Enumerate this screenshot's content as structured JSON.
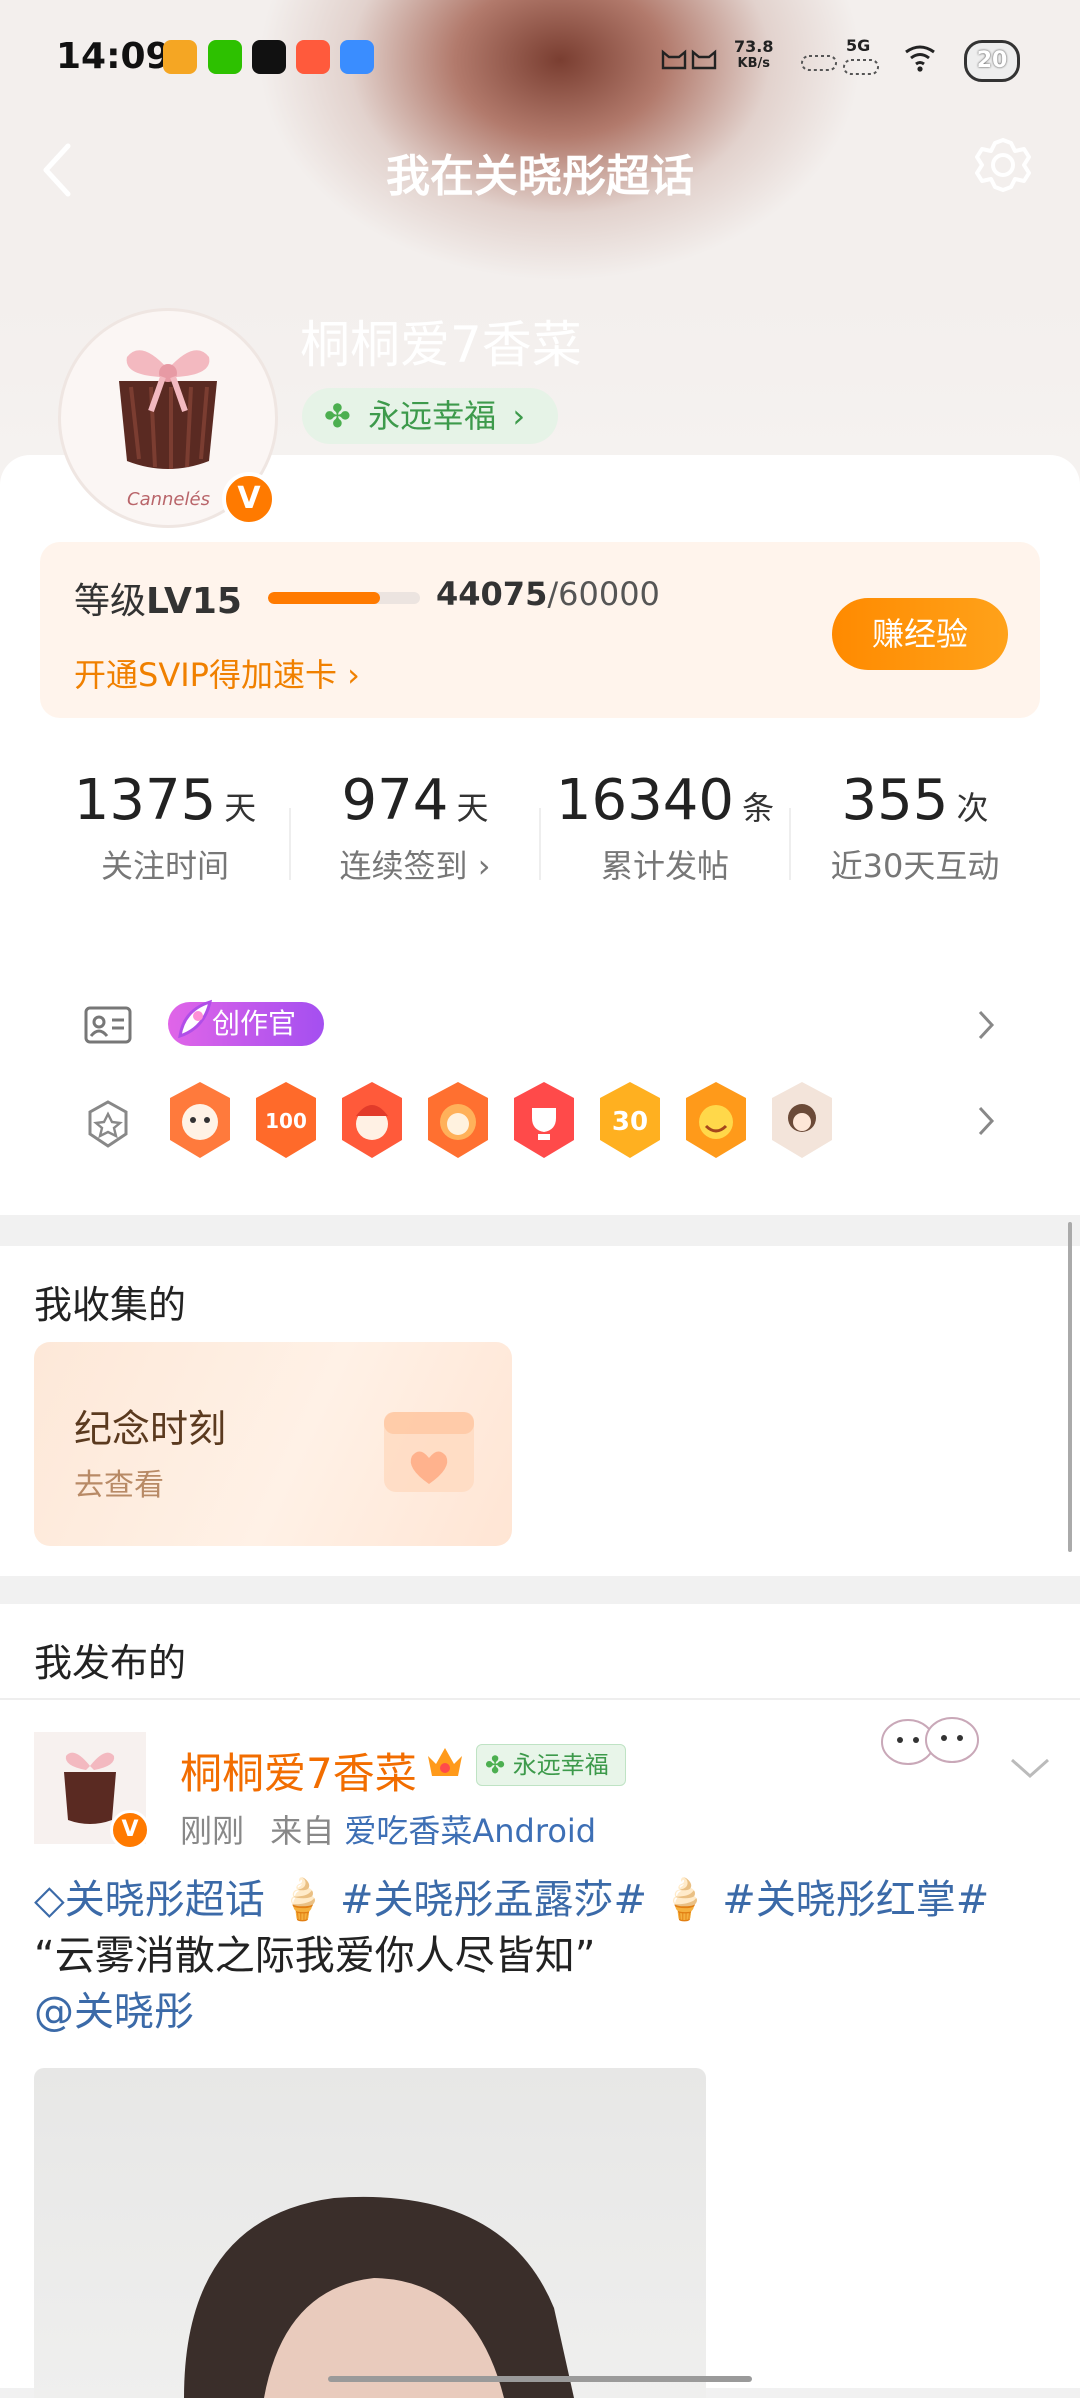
{
  "status_bar": {
    "time": "14:09",
    "speed_value": "73.8",
    "speed_unit": "KB/s",
    "signal_label": "5G",
    "battery": "20",
    "app_icons": [
      "weibo-icon",
      "wechat-icon",
      "tiktok-icon",
      "app-icon-red",
      "app-icon-blue"
    ]
  },
  "nav": {
    "title": "我在关晓彤超话"
  },
  "profile": {
    "nickname": "桐桐爱7香菜",
    "luck_badge": "永远幸福",
    "avatar_caption": "Cannelés",
    "verified_mark": "V"
  },
  "level": {
    "label_prefix": "等级",
    "level": "LV15",
    "progress_current": "44075",
    "progress_total": "/60000",
    "progress_fraction": 0.7346,
    "svip_text": "开通SVIP得加速卡",
    "earn_button": "赚经验"
  },
  "stats": [
    {
      "value": "1375",
      "unit": "天",
      "label": "关注时间"
    },
    {
      "value": "974",
      "unit": "天",
      "label": "连续签到"
    },
    {
      "value": "16340",
      "unit": "条",
      "label": "累计发帖"
    },
    {
      "value": "355",
      "unit": "次",
      "label": "近30天互动"
    }
  ],
  "badges": {
    "creator_badge": "创作官",
    "medals": [
      "medal-cat",
      "medal-100-days",
      "medal-red-hood",
      "medal-lion",
      "medal-trophy",
      "medal-30-days",
      "medal-emoji",
      "medal-girl"
    ]
  },
  "collected": {
    "title": "我收集的",
    "card_title": "纪念时刻",
    "card_sub": "去查看"
  },
  "posted": {
    "title": "我发布的",
    "author": "桐桐爱7香菜",
    "author_pill": "永远幸福",
    "meta_time": "刚刚",
    "meta_from": "来自",
    "meta_source": "爱吃香菜Android",
    "topic1": "关晓彤超话",
    "topic2": "#关晓彤孟露莎#",
    "topic3": "#关晓彤红掌#",
    "quote": "“云雾消散之际我爱你人尽皆知”",
    "mention": "@关晓彤"
  },
  "colors": {
    "accent": "#ff7a00",
    "topic": "#3b6aa8",
    "green": "#3d9a4b"
  }
}
